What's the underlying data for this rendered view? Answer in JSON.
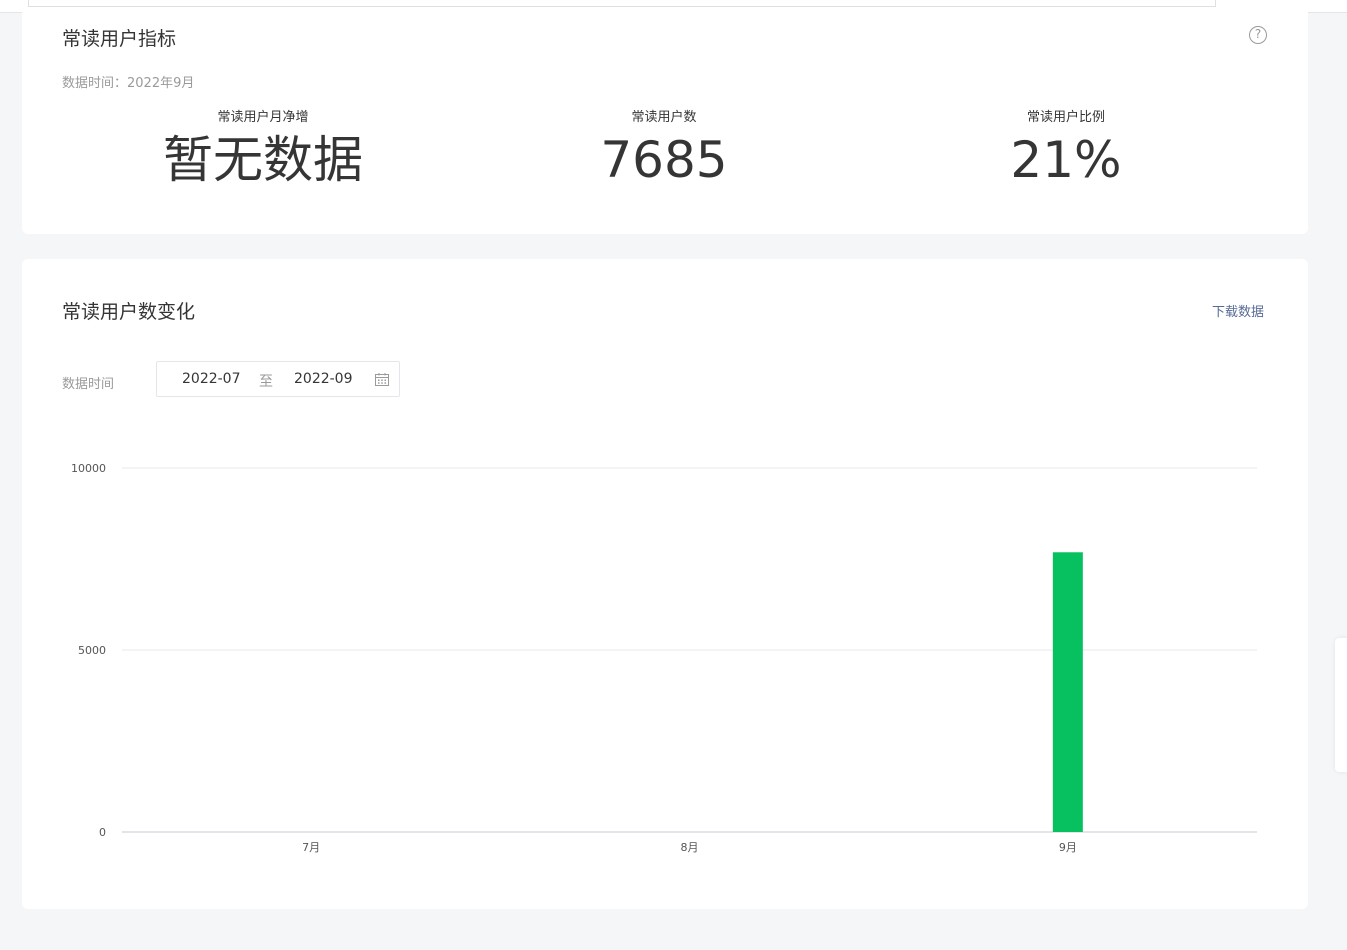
{
  "metrics_card": {
    "title": "常读用户指标",
    "data_time": "数据时间：2022年9月",
    "help_icon": "question-circle-icon",
    "metrics": [
      {
        "label": "常读用户月净增",
        "value": "暂无数据"
      },
      {
        "label": "常读用户数",
        "value": "7685"
      },
      {
        "label": "常读用户比例",
        "value": "21%"
      }
    ]
  },
  "chart_card": {
    "title": "常读用户数变化",
    "download_label": "下载数据",
    "filter_label": "数据时间",
    "date_start": "2022-07",
    "date_separator": "至",
    "date_end": "2022-09",
    "calendar_icon": "calendar-icon"
  },
  "chart_data": {
    "type": "bar",
    "categories": [
      "7月",
      "8月",
      "9月"
    ],
    "values": [
      0,
      0,
      7685
    ],
    "yticks": [
      0,
      5000,
      10000
    ],
    "ylim": [
      0,
      10000
    ],
    "bar_color": "#07c160",
    "grid": true
  },
  "colors": {
    "accent": "#07c160",
    "link": "#576b95",
    "muted": "#9a9a9a",
    "text": "#353535"
  }
}
